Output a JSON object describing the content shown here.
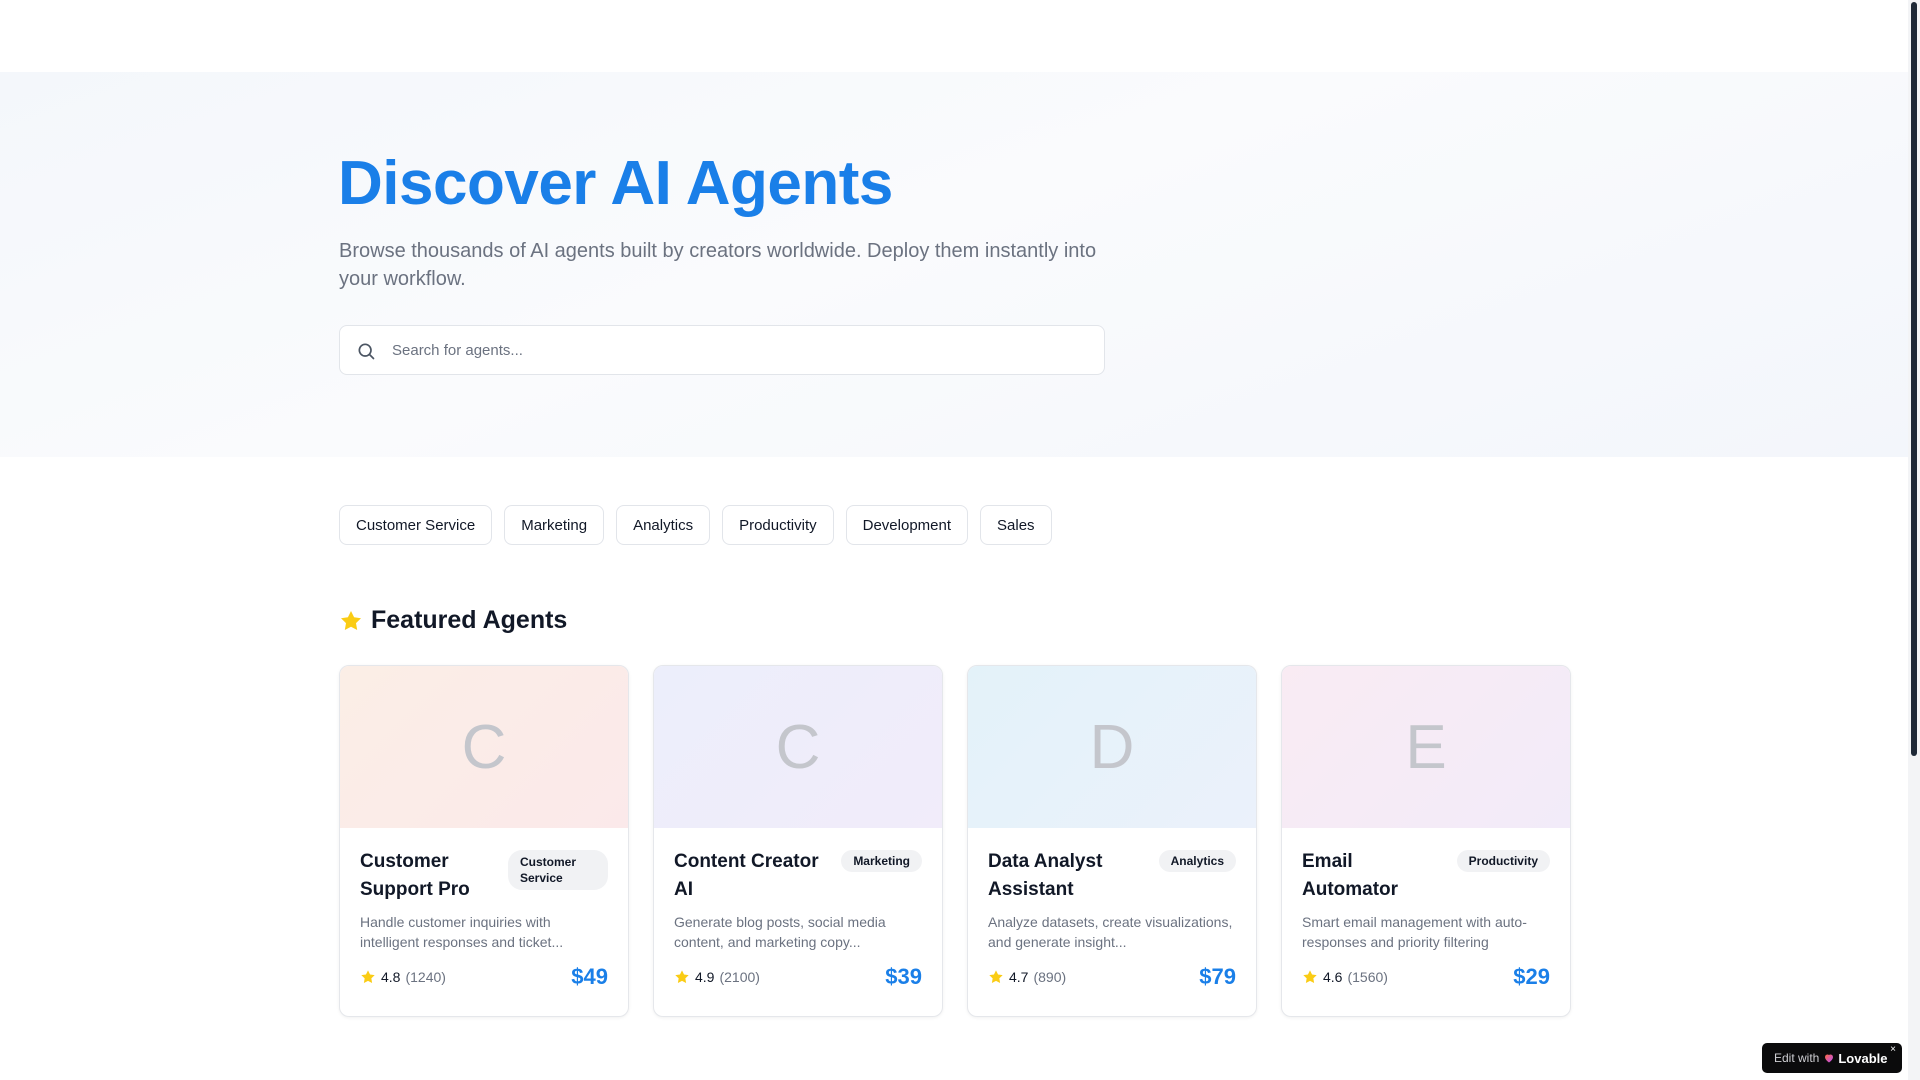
{
  "hero": {
    "title": "Discover AI Agents",
    "subtitle": "Browse thousands of AI agents built by creators worldwide. Deploy them instantly into your workflow.",
    "search_placeholder": "Search for agents..."
  },
  "categories": [
    "Customer Service",
    "Marketing",
    "Analytics",
    "Productivity",
    "Development",
    "Sales"
  ],
  "featured": {
    "title": "Featured Agents",
    "icon": "star-icon",
    "accent_color": "#facc15"
  },
  "agents": [
    {
      "initial": "C",
      "name": "Customer Support Pro",
      "category": "Customer Service",
      "description": "Handle customer inquiries with intelligent responses and ticket...",
      "rating": "4.8",
      "reviews": "(1240)",
      "price": "$49",
      "gradient": [
        "#fbeee6",
        "#fbe9ea"
      ]
    },
    {
      "initial": "C",
      "name": "Content Creator AI",
      "category": "Marketing",
      "description": "Generate blog posts, social media content, and marketing copy...",
      "rating": "4.9",
      "reviews": "(2100)",
      "price": "$39",
      "gradient": [
        "#eceefb",
        "#f1ecfa"
      ]
    },
    {
      "initial": "D",
      "name": "Data Analyst Assistant",
      "category": "Analytics",
      "description": "Analyze datasets, create visualizations, and generate insight...",
      "rating": "4.7",
      "reviews": "(890)",
      "price": "$79",
      "gradient": [
        "#e3f2f9",
        "#ebf1fb"
      ]
    },
    {
      "initial": "E",
      "name": "Email Automator",
      "category": "Productivity",
      "description": "Smart email management with auto-responses and priority filtering",
      "rating": "4.6",
      "reviews": "(1560)",
      "price": "$29",
      "gradient": [
        "#f9ebf3",
        "#f2ebf9"
      ]
    }
  ],
  "colors": {
    "brand": "#1a7fe8",
    "star": "#facc15",
    "muted_text": "#6b7280"
  },
  "edit_badge": {
    "prefix": "Edit with",
    "brand": "Lovable",
    "close": "×"
  }
}
